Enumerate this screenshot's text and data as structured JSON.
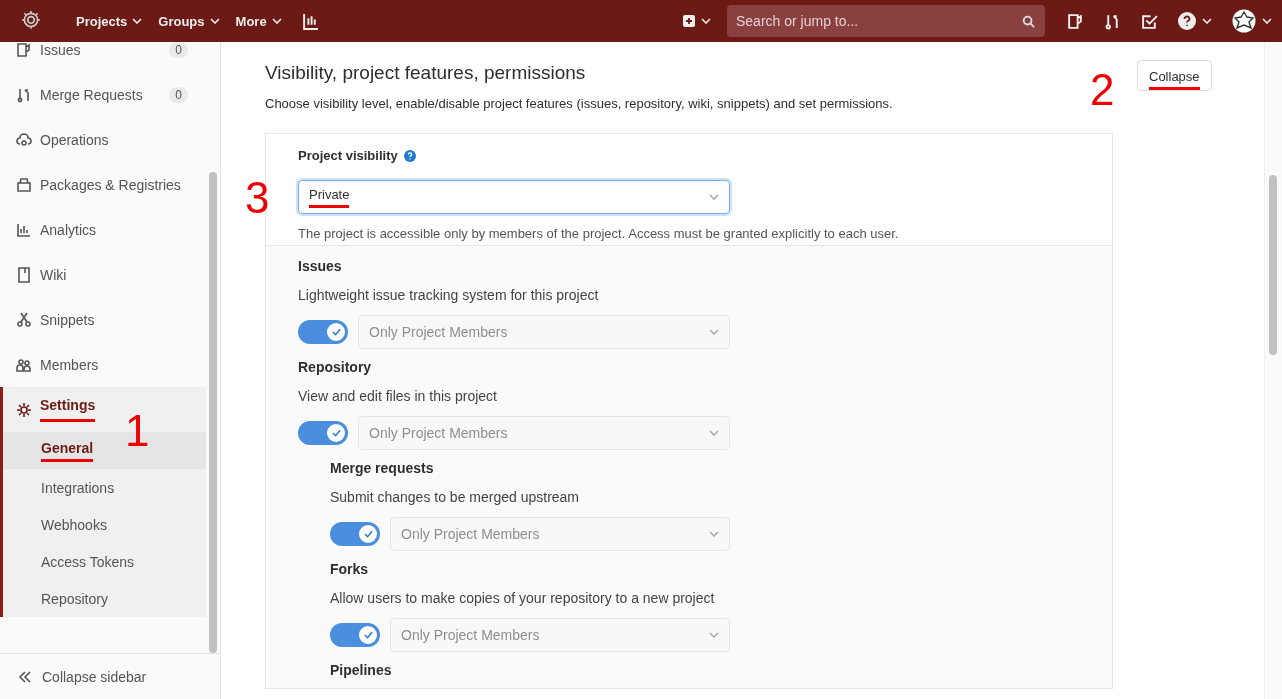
{
  "topbar": {
    "nav": [
      {
        "label": "Projects"
      },
      {
        "label": "Groups"
      },
      {
        "label": "More"
      }
    ],
    "search": {
      "placeholder": "Search or jump to..."
    }
  },
  "sidebar": {
    "items": [
      {
        "label": "Issues",
        "count": "0",
        "selected": false,
        "underlined": false
      },
      {
        "label": "Merge Requests",
        "count": "0",
        "selected": false,
        "underlined": false
      },
      {
        "label": "Operations",
        "selected": false,
        "underlined": false
      },
      {
        "label": "Packages & Registries",
        "selected": false,
        "underlined": false
      },
      {
        "label": "Analytics",
        "selected": false,
        "underlined": false
      },
      {
        "label": "Wiki",
        "selected": false,
        "underlined": false
      },
      {
        "label": "Snippets",
        "selected": false,
        "underlined": false
      },
      {
        "label": "Members",
        "selected": false,
        "underlined": false
      },
      {
        "label": "Settings",
        "selected": true,
        "underlined": true,
        "annotation": "1",
        "children": [
          {
            "label": "General",
            "selected": true,
            "underlined": true
          },
          {
            "label": "Integrations",
            "selected": false,
            "underlined": false
          },
          {
            "label": "Webhooks",
            "selected": false,
            "underlined": false
          },
          {
            "label": "Access Tokens",
            "selected": false,
            "underlined": false
          },
          {
            "label": "Repository",
            "selected": false,
            "underlined": false
          }
        ]
      }
    ],
    "collapse_label": "Collapse sidebar"
  },
  "section": {
    "title": "Visibility, project features, permissions",
    "description": "Choose visibility level, enable/disable project features (issues, repository, wiki, snippets) and set permissions.",
    "button": {
      "label": "Collapse",
      "underlined": true,
      "annotation": "2"
    }
  },
  "visibility": {
    "label": "Project visibility",
    "value": "Private",
    "underlined": true,
    "annotation": "3",
    "help": "The project is accessible only by members of the project. Access must be granted explicitly to each user."
  },
  "features": [
    {
      "title": "Issues",
      "description": "Lightweight issue tracking system for this project",
      "on": true,
      "value": "Only Project Members"
    },
    {
      "title": "Repository",
      "description": "View and edit files in this project",
      "on": true,
      "value": "Only Project Members",
      "children": [
        {
          "title": "Merge requests",
          "description": "Submit changes to be merged upstream",
          "on": true,
          "value": "Only Project Members"
        },
        {
          "title": "Forks",
          "description": "Allow users to make copies of your repository to a new project",
          "on": true,
          "value": "Only Project Members"
        },
        {
          "title": "Pipelines"
        }
      ]
    }
  ]
}
